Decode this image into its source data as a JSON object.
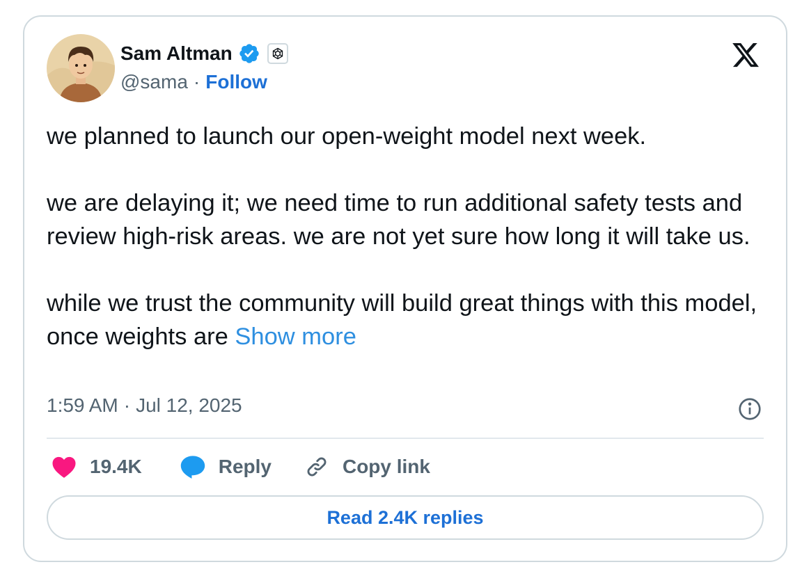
{
  "author": {
    "name": "Sam Altman",
    "handle": "@sama",
    "separator": "·",
    "follow_label": "Follow"
  },
  "tweet": {
    "paragraphs": [
      "we planned to launch our open-weight model next week.",
      "we are delaying it; we need time to run additional safety tests and review high-risk areas. we are not yet sure how long it will take us.",
      "while we trust the community will build great things with this model, once weights are"
    ],
    "show_more_label": "Show more"
  },
  "meta": {
    "time": "1:59 AM",
    "separator": "·",
    "date": "Jul 12, 2025"
  },
  "actions": {
    "like_count": "19.4K",
    "reply_label": "Reply",
    "copy_link_label": "Copy link"
  },
  "read_replies_label": "Read 2.4K replies",
  "icons": [
    "verified-badge-icon",
    "openai-affiliate-icon",
    "x-logo-icon",
    "info-icon",
    "heart-icon",
    "reply-bubble-icon",
    "link-icon"
  ],
  "colors": {
    "link_blue": "#1d70d6",
    "show_more_blue": "#2e8fe0",
    "like_pink": "#f91880",
    "verified_blue": "#1d9bf0",
    "secondary_text": "#536471",
    "border": "#cfd9de"
  }
}
